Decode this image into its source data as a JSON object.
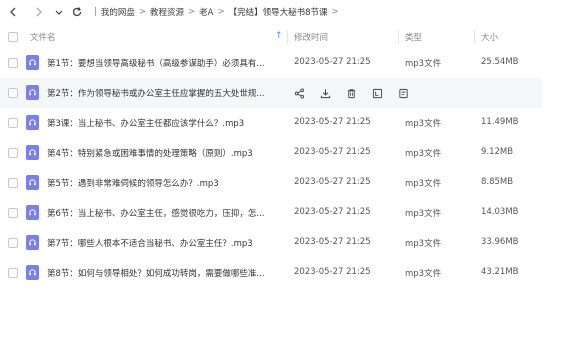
{
  "breadcrumb": [
    "我的网盘",
    "教程资源",
    "老A",
    "【完结】领导大秘书8节课"
  ],
  "columns": {
    "name": "文件名",
    "time": "修改时间",
    "type": "类型",
    "size": "大小"
  },
  "files": [
    {
      "name": "第1节：要想当领导高级秘书（高级参谋助手）必须具有...",
      "time": "2023-05-27 21:25",
      "type": "mp3文件",
      "size": "25.54MB"
    },
    {
      "name": "第2节：作为领导秘书或办公室主任应掌握的五大处世规...",
      "time": "",
      "type": "",
      "size": ""
    },
    {
      "name": "第3课：当上秘书、办公室主任都应该学什么？.mp3",
      "time": "2023-05-27 21:25",
      "type": "mp3文件",
      "size": "11.49MB"
    },
    {
      "name": "第4节：特别紧急或困难事情的处理策略（原则）.mp3",
      "time": "2023-05-27 21:25",
      "type": "mp3文件",
      "size": "9.12MB"
    },
    {
      "name": "第5节：遇到非常难伺候的领导怎么办？.mp3",
      "time": "2023-05-27 21:25",
      "type": "mp3文件",
      "size": "8.85MB"
    },
    {
      "name": "第6节：当上秘书、办公室主任，感觉很吃力，压抑，怎...",
      "time": "2023-05-27 21:25",
      "type": "mp3文件",
      "size": "14.03MB"
    },
    {
      "name": "第7节：哪些人根本不适合当秘书、办公室主任？.mp3",
      "time": "2023-05-27 21:25",
      "type": "mp3文件",
      "size": "33.96MB"
    },
    {
      "name": "第8节：如何与领导相处？如何成功转岗，需要做哪些准...",
      "time": "2023-05-27 21:25",
      "type": "mp3文件",
      "size": "43.21MB"
    }
  ],
  "row_actions": [
    "share-icon",
    "download-icon",
    "delete-icon",
    "rename-icon",
    "more-icon"
  ],
  "colors": {
    "accent": "#4a8fe8",
    "file_icon": "#7b7fe8"
  }
}
